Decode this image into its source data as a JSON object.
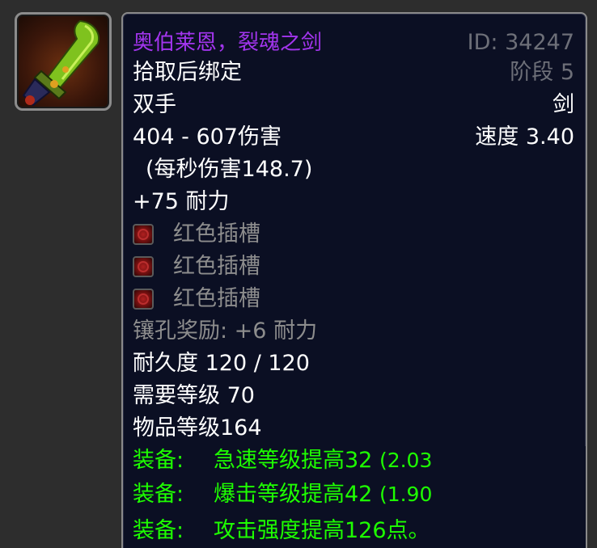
{
  "item": {
    "icon_name": "sword-icon",
    "name": "奥伯莱恩，裂魂之剑",
    "id_label": "ID: 34247",
    "bind": "拾取后绑定",
    "phase": "阶段 5",
    "slot": "双手",
    "type": "剑",
    "damage": "404 - 607伤害",
    "speed": "速度 3.40",
    "dps": "(每秒伤害148.7)",
    "stamina": "+75 耐力",
    "sockets": [
      {
        "label": "红色插槽",
        "icon": "red-socket-icon"
      },
      {
        "label": "红色插槽",
        "icon": "red-socket-icon"
      },
      {
        "label": "红色插槽",
        "icon": "red-socket-icon"
      }
    ],
    "socket_bonus": "镶孔奖励: +6 耐力",
    "durability": "耐久度 120 / 120",
    "required_level": "需要等级 70",
    "item_level": "物品等级164",
    "equip_effects": [
      {
        "label": "装备:",
        "text": "急速等级提高32",
        "extra": "(2.03"
      },
      {
        "label": "装备:",
        "text": "爆击等级提高42",
        "extra": "(1.90"
      },
      {
        "label": "装备:",
        "text": "攻击强度提高126点。",
        "extra": ""
      }
    ]
  },
  "colors": {
    "epic_name": "#a335ee",
    "equip_green": "#1eff00",
    "socket_grey": "#8d8d8d",
    "tooltip_bg": "#0b0f23"
  }
}
